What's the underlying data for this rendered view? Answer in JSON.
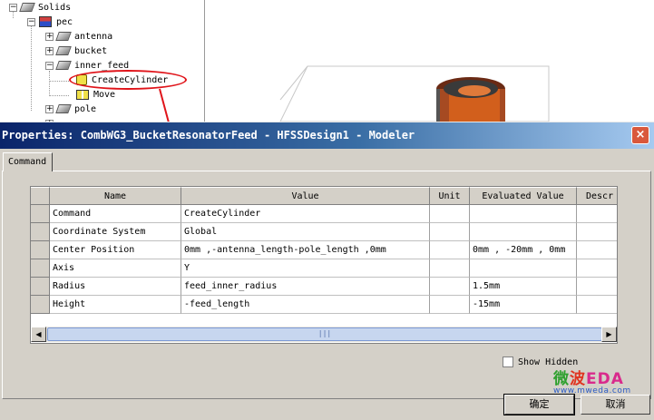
{
  "tree": {
    "items": [
      {
        "label": "Solids",
        "icon": "solids-folder-icon"
      },
      {
        "label": "pec",
        "icon": "pec-material-icon"
      },
      {
        "label": "antenna",
        "icon": "solid-object-icon"
      },
      {
        "label": "bucket",
        "icon": "solid-object-icon"
      },
      {
        "label": "inner_feed",
        "icon": "solid-object-icon"
      },
      {
        "label": "CreateCylinder",
        "icon": "cylinder-command-icon"
      },
      {
        "label": "Move",
        "icon": "move-command-icon"
      },
      {
        "label": "pole",
        "icon": "solid-object-icon"
      }
    ],
    "expanders": [
      "−",
      "−",
      "+",
      "+",
      "−",
      "+",
      "+"
    ]
  },
  "dialog": {
    "title": "Properties: CombWG3_BucketResonatorFeed - HFSSDesign1 - Modeler",
    "close_label": "×",
    "tab_label": "Command",
    "columns": [
      "Name",
      "Value",
      "Unit",
      "Evaluated Value",
      "Descr"
    ],
    "rows": [
      [
        "Command",
        "CreateCylinder",
        "",
        ""
      ],
      [
        "Coordinate System",
        "Global",
        "",
        ""
      ],
      [
        "Center Position",
        "0mm ,-antenna_length-pole_length ,0mm",
        "",
        "0mm , -20mm , 0mm"
      ],
      [
        "Axis",
        "Y",
        "",
        ""
      ],
      [
        "Radius",
        "feed_inner_radius",
        "",
        "1.5mm"
      ],
      [
        "Height",
        "-feed_length",
        "",
        "-15mm"
      ]
    ],
    "scroll_left": "◀",
    "scroll_right": "▶",
    "scroll_grip": "|||",
    "show_hidden_label": "Show Hidden",
    "ok_label": "确定",
    "cancel_label": "取消"
  },
  "watermark": {
    "part1": "微",
    "part2": "波",
    "part3": "EDA",
    "url": "www.mweda.com"
  },
  "colors": {
    "highlight": "#e0141a",
    "title_start": "#0a246a",
    "title_end": "#a6caf0"
  }
}
